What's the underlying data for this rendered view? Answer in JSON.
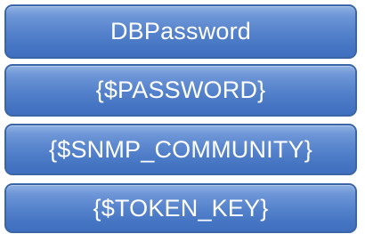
{
  "boxes": [
    {
      "label": "DBPassword"
    },
    {
      "label": "{$PASSWORD}"
    },
    {
      "label": "{$SNMP_COMMUNITY}"
    },
    {
      "label": "{$TOKEN_KEY}"
    }
  ],
  "colors": {
    "box_fill": "#5683cc",
    "box_border": "#3a66a8",
    "text": "#ffffff"
  }
}
